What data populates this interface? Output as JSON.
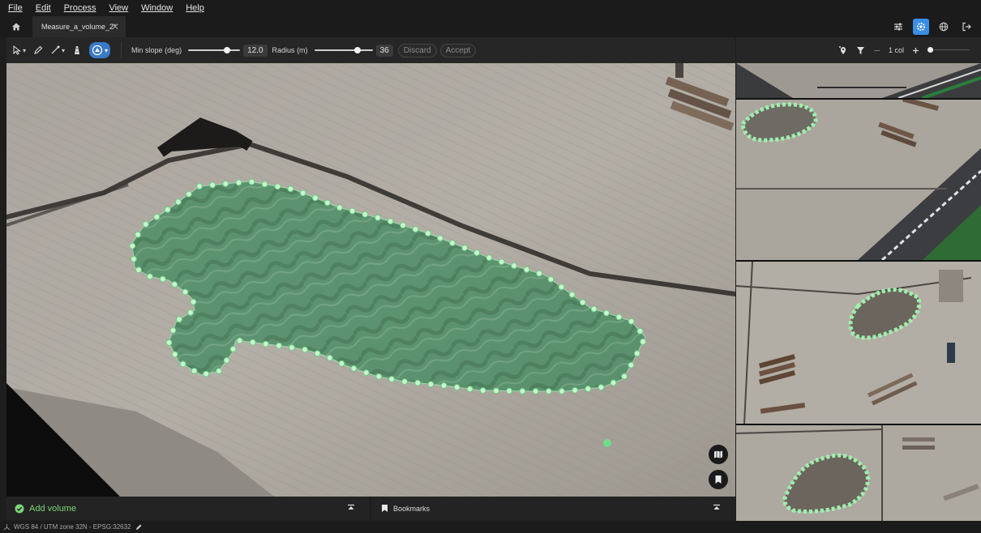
{
  "menu": [
    "File",
    "Edit",
    "Process",
    "View",
    "Window",
    "Help"
  ],
  "tab": {
    "title": "Measure_a_volume_2*"
  },
  "toolbar": {
    "min_slope_label": "Min slope (deg)",
    "min_slope_value": "12.0",
    "min_slope_fraction": 0.78,
    "radius_label": "Radius (m)",
    "radius_value": "36",
    "radius_fraction": 0.78,
    "discard_label": "Discard",
    "accept_label": "Accept"
  },
  "right_toolbar": {
    "columns_label": "1 col",
    "columns_fraction": 0.0
  },
  "bottom": {
    "add_volume_label": "Add volume",
    "bookmarks_label": "Bookmarks"
  },
  "status": {
    "crs_text": "WGS 84 / UTM zone 32N - EPSG:32632"
  },
  "colors": {
    "accent_blue": "#3a8ee6",
    "polygon_fill": "#5fc483",
    "vertex": "#c9f5cf",
    "add_volume_green": "#7bd57a"
  },
  "icons": {
    "home": "home-icon",
    "top_right": [
      "sliders-icon",
      "settings-icon",
      "globe-icon",
      "logout-icon"
    ],
    "tools": [
      "pointer-icon",
      "pen-icon",
      "line-icon",
      "road-icon",
      "volume-tool-icon"
    ],
    "right_tools": [
      "add-pin-icon",
      "filter-icon",
      "minus-icon",
      "plus-icon"
    ],
    "viewport_buttons": [
      "map-icon",
      "bookmark-icon"
    ]
  }
}
